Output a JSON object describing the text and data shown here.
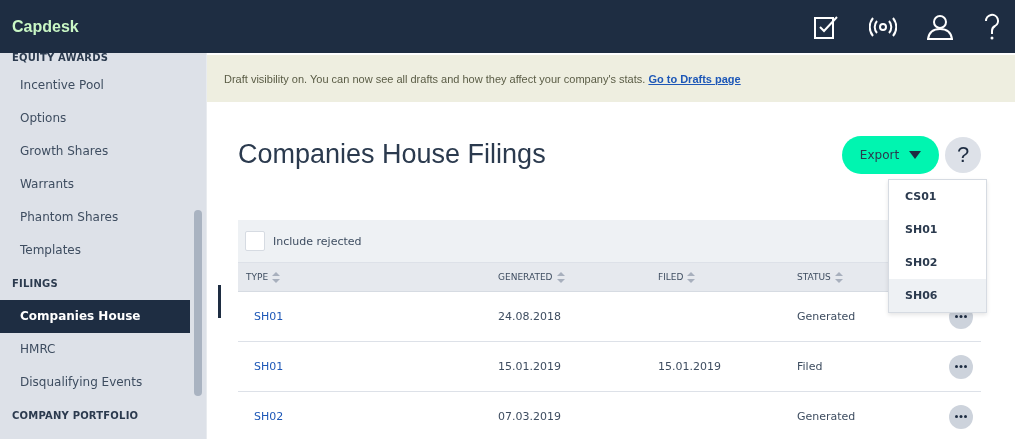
{
  "header": {
    "logo": "Capdesk"
  },
  "sidebar": {
    "sections": [
      {
        "title": "EQUITY AWARDS",
        "items": [
          {
            "label": "Incentive Pool",
            "selected": false
          },
          {
            "label": "Options",
            "selected": false
          },
          {
            "label": "Growth Shares",
            "selected": false
          },
          {
            "label": "Warrants",
            "selected": false
          },
          {
            "label": "Phantom Shares",
            "selected": false
          },
          {
            "label": "Templates",
            "selected": false
          }
        ]
      },
      {
        "title": "FILINGS",
        "items": [
          {
            "label": "Companies House",
            "selected": true
          },
          {
            "label": "HMRC",
            "selected": false
          },
          {
            "label": "Disqualifying Events",
            "selected": false
          }
        ]
      },
      {
        "title": "COMPANY PORTFOLIO"
      }
    ]
  },
  "banner": {
    "text": "Draft visibility on. You can now see all drafts and how they affect your company's stats.",
    "link": "Go to Drafts page"
  },
  "page": {
    "title": "Companies House Filings",
    "export_button": "Export",
    "help_button": "?"
  },
  "export_menu": [
    {
      "label": "CS01",
      "selected": false
    },
    {
      "label": "SH01",
      "selected": false
    },
    {
      "label": "SH02",
      "selected": false
    },
    {
      "label": "SH06",
      "selected": true
    }
  ],
  "filter": {
    "label": "Include rejected",
    "checked": false
  },
  "table": {
    "columns": [
      "TYPE",
      "GENERATED",
      "FILED",
      "STATUS"
    ],
    "rows": [
      {
        "type": "SH01",
        "generated": "24.08.2018",
        "filed": "",
        "status": "Generated"
      },
      {
        "type": "SH01",
        "generated": "15.01.2019",
        "filed": "15.01.2019",
        "status": "Filed"
      },
      {
        "type": "SH02",
        "generated": "07.03.2019",
        "filed": "",
        "status": "Generated"
      }
    ]
  }
}
